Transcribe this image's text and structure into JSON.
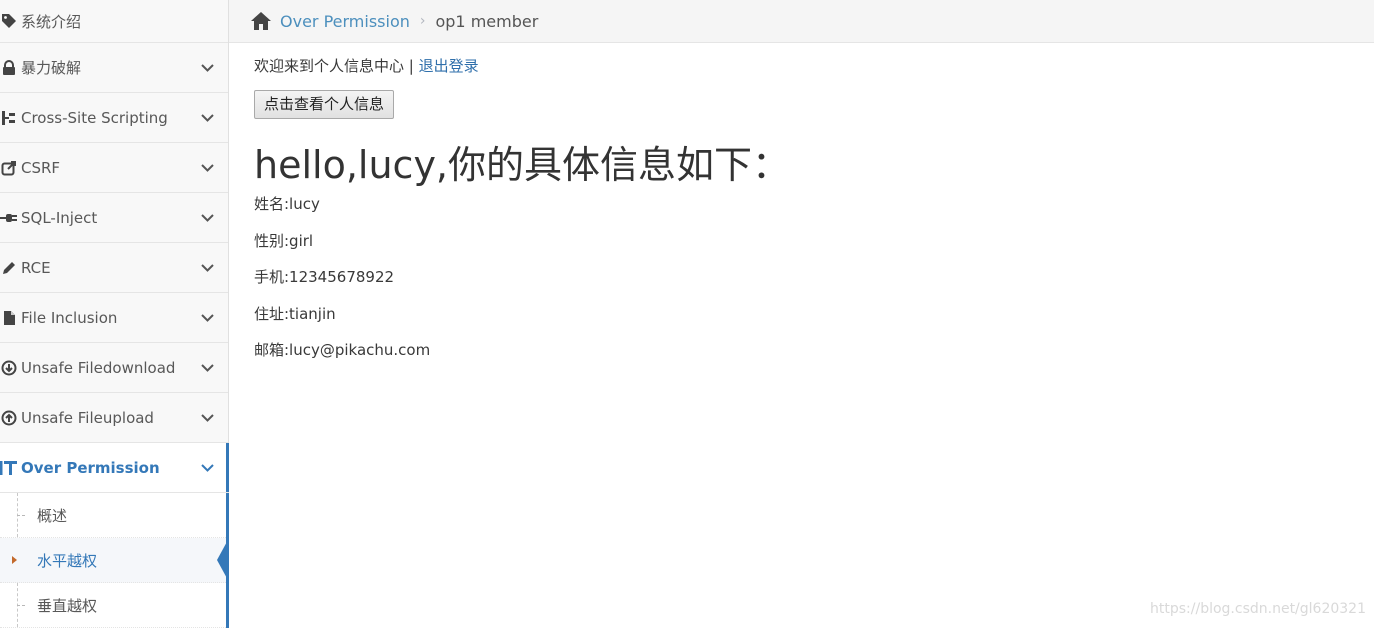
{
  "sidebar": {
    "items": [
      {
        "label": "系统介绍",
        "icon": "tag-icon"
      },
      {
        "label": "暴力破解",
        "icon": "lock-icon"
      },
      {
        "label": "Cross-Site Scripting",
        "icon": "sitemap-icon"
      },
      {
        "label": "CSRF",
        "icon": "share-icon"
      },
      {
        "label": "SQL-Inject",
        "icon": "plug-icon"
      },
      {
        "label": "RCE",
        "icon": "pencil-icon"
      },
      {
        "label": "File Inclusion",
        "icon": "file-icon"
      },
      {
        "label": "Unsafe Filedownload",
        "icon": "download-circle-icon"
      },
      {
        "label": "Unsafe Fileupload",
        "icon": "upload-circle-icon"
      },
      {
        "label": "Over Permission",
        "icon": "text-height-icon"
      }
    ],
    "submenu": [
      {
        "label": "概述"
      },
      {
        "label": "水平越权"
      },
      {
        "label": "垂直越权"
      }
    ]
  },
  "breadcrumb": {
    "parent": "Over Permission",
    "current": "op1 member"
  },
  "main": {
    "welcome_text": "欢迎来到个人信息中心 | ",
    "logout_label": "退出登录",
    "view_button_label": "点击查看个人信息",
    "heading": "hello,lucy,你的具体信息如下：",
    "fields": {
      "name": "姓名:lucy",
      "gender": "性别:girl",
      "phone": "手机:12345678922",
      "address": "住址:tianjin",
      "email": "邮箱:lucy@pikachu.com"
    }
  },
  "watermark": "https://blog.csdn.net/gl620321",
  "colors": {
    "accent": "#3478b8",
    "link": "#4c8fbd",
    "sidebar_bg": "#f8f8f8"
  }
}
